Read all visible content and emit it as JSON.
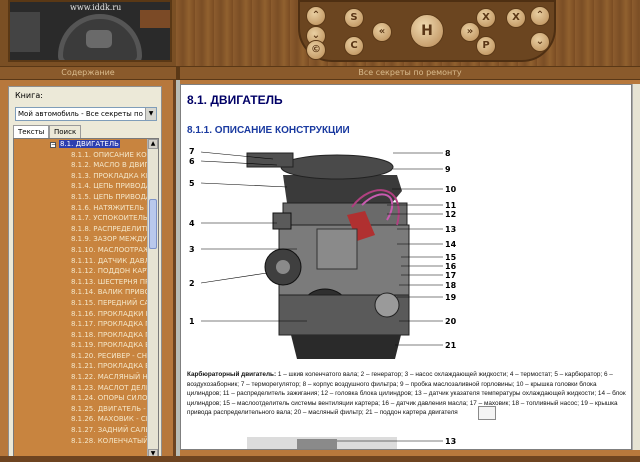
{
  "header": {
    "site_url": "www.iddk.ru",
    "nav_buttons": {
      "up": "⌃",
      "down": "⌄",
      "copyright": "©",
      "s": "S",
      "c": "C",
      "x_left": "X",
      "x_right": "X",
      "prev": "«",
      "next": "»",
      "home": "H",
      "p": "P",
      "up_right": "⌃",
      "down_right": "⌄"
    }
  },
  "tabs": {
    "contents": "Содержание",
    "secrets": "Все секреты по ремонту"
  },
  "sidebar": {
    "book_label": "Книга:",
    "book_value": "Мой автомобиль - Все секреты по ре",
    "tab_texts": "Тексты",
    "tab_search": "Поиск",
    "selected": "8.1. ДВИГАТЕЛЬ",
    "items": [
      "8.1.1. ОПИСАНИЕ КОНС",
      "8.1.2. МАСЛО В ДВИГАТ",
      "8.1.3. ПРОКЛАДКА КРЫ",
      "8.1.4. ЦЕПЬ ПРИВОДА Г",
      "8.1.5. ЦЕПЬ ПРИВОДА Р",
      "8.1.6. НАТЯЖИТЕЛЬ ЦЕ",
      "8.1.7. УСПОКОИТЕЛЬ Ц",
      "8.1.8. РАСПРЕДЕЛИТЕЛ",
      "8.1.9. ЗАЗОР МЕЖДУ Р",
      "8.1.10. МАСЛООТРАЖАТ",
      "8.1.11. ДАТЧИК ДАВЛЕ",
      "8.1.12. ПОДДОН КАРТЕ",
      "8.1.13. ШЕСТЕРНЯ ПРИ",
      "8.1.14. ВАЛИК ПРИВОД",
      "8.1.15. ПЕРЕДНИЙ САЛ",
      "8.1.16. ПРОКЛАДКИ ВП",
      "8.1.17. ПРОКЛАДКА ГО",
      "8.1.18. ПРОКЛАДКА ГО",
      "8.1.19. ПРОКЛАДКА ВЫ",
      "8.1.20. РЕСИВЕР - СНЯТ",
      "8.1.21. ПРОКЛАДКА ВП",
      "8.1.22. МАСЛЯНЫЙ НАС",
      "8.1.23. МАСЛОТ ДЕЛИТ",
      "8.1.24. ОПОРЫ СИЛОВО",
      "8.1.25. ДВИГАТЕЛЬ - СН",
      "8.1.26. МАХОВИК - СНЯ",
      "8.1.27. ЗАДНИЙ САЛЬН",
      "8.1.28. КОЛЕНЧАТЫЙ В"
    ]
  },
  "content": {
    "title": "8.1. ДВИГАТЕЛЬ",
    "subtitle": "8.1.1. ОПИСАНИЕ КОНСТРУКЦИИ",
    "left_callouts": [
      "7",
      "6",
      "5",
      "4",
      "3",
      "2",
      "1"
    ],
    "right_callouts": [
      "8",
      "9",
      "10",
      "11",
      "12",
      "13",
      "14",
      "15",
      "16",
      "17",
      "18",
      "19",
      "20",
      "21"
    ],
    "caption_bold": "Карбюраторный двигатель:",
    "caption_text": " 1 – шкив коленчатого вала; 2 – генератор; 3 – насос охлаждающей жидкости; 4 – термостат; 5 – карбюратор; 6 – воздухозаборник; 7 – терморегулятор; 8 – корпус воздушного фильтра; 9 – пробка маслозаливной горловины; 10 – крышка головки блока цилиндров; 11 – распределитель зажигания; 12 – головка блока цилиндров; 13 – датчик указателя температуры охлаждающей жидкости; 14 – блок цилиндров; 15 – маслоотделитель системы вентиляции картера; 16 – датчик давления масла; 17 – маховик; 18 – топливный насос; 19 – крышка привода распределительного вала; 20 – масляный фильтр; 21 – поддон картера двигателя",
    "figure2_callout": "13"
  },
  "colors": {
    "header_wood": "#7a4f24",
    "panel_orange": "#c8843f",
    "tree_text": "#f4e6c8",
    "title_blue": "#000066",
    "subtitle_blue": "#1a3aa0",
    "selection_blue": "#2c3eb0"
  }
}
